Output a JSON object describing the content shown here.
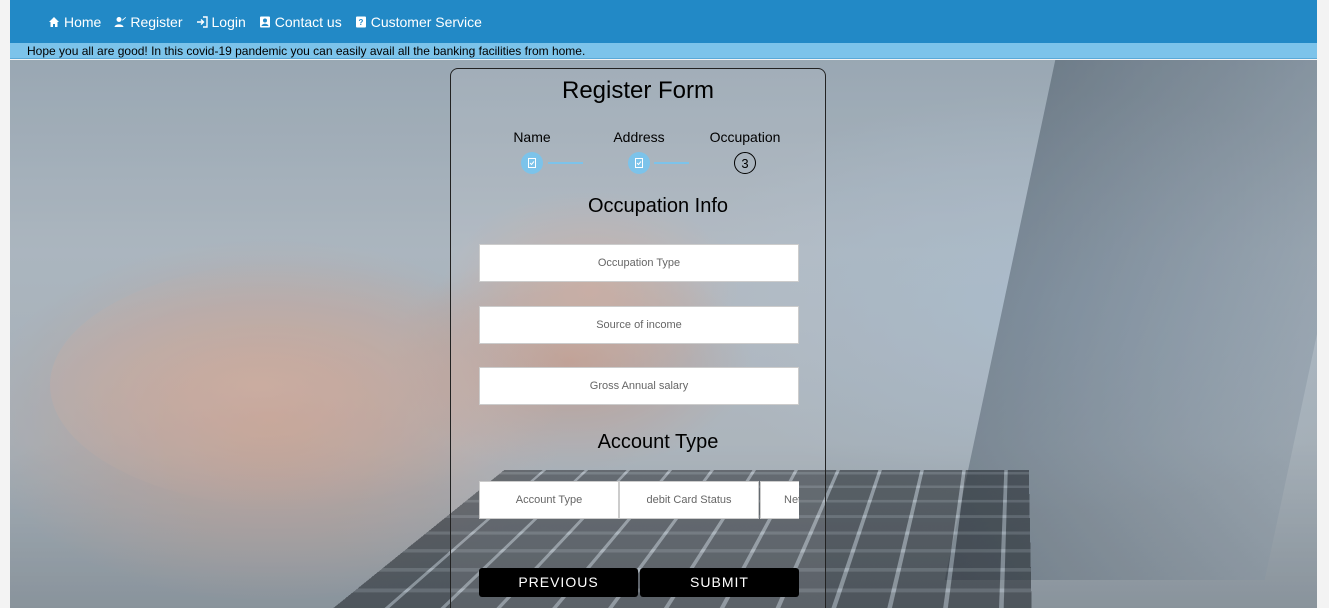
{
  "nav": {
    "items": [
      {
        "label": "Home",
        "icon": "home-icon"
      },
      {
        "label": "Register",
        "icon": "register-icon"
      },
      {
        "label": "Login",
        "icon": "login-icon"
      },
      {
        "label": "Contact us",
        "icon": "contact-card-icon"
      },
      {
        "label": "Customer Service",
        "icon": "help-icon"
      }
    ]
  },
  "marquee": "Hope you all are good! In this covid-19 pandemic you can easily avail all the banking facilities from home.",
  "form": {
    "title": "Register Form",
    "steps": [
      {
        "label": "Name",
        "state": "done"
      },
      {
        "label": "Address",
        "state": "done"
      },
      {
        "label": "Occupation",
        "state": "current",
        "number": "3"
      }
    ],
    "occupation_section": "Occupation Info",
    "occupation_type_placeholder": "Occupation Type",
    "source_income_placeholder": "Source of income",
    "gross_salary_placeholder": "Gross Annual salary",
    "account_section": "Account Type",
    "account_type_placeholder": "Account Type",
    "debit_card_placeholder": "debit Card Status",
    "net_banking_placeholder": "Net",
    "previous_label": "PREVIOUS",
    "submit_label": "SUBMIT"
  },
  "colors": {
    "navbar": "#2289c6",
    "marquee": "#7cc3ea",
    "step_done": "#7cc3ea",
    "button": "#000000"
  }
}
